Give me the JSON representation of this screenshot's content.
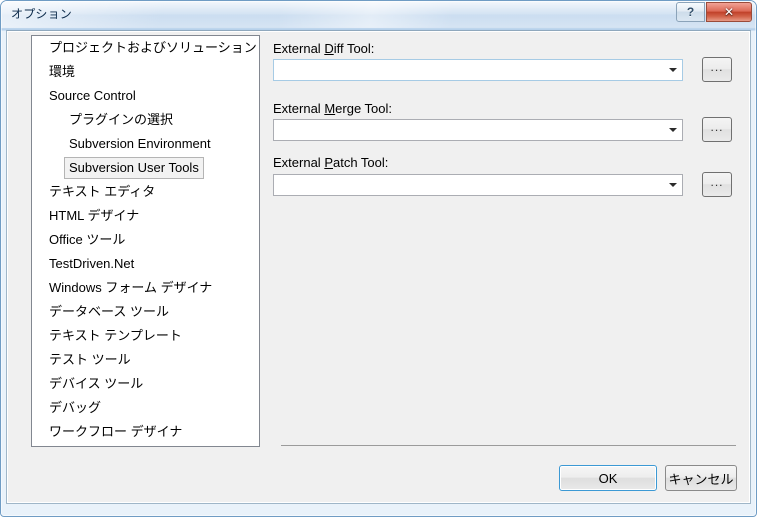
{
  "window": {
    "title": "オプション",
    "caption_buttons": [
      {
        "name": "help-button",
        "glyph": "?"
      },
      {
        "name": "close-button",
        "glyph": "✕"
      }
    ]
  },
  "tree": {
    "items": [
      {
        "label": "プロジェクトおよびソリューション",
        "level": 0,
        "selected": false
      },
      {
        "label": "環境",
        "level": 0,
        "selected": false
      },
      {
        "label": "Source Control",
        "level": 0,
        "selected": false
      },
      {
        "label": "プラグインの選択",
        "level": 1,
        "selected": false
      },
      {
        "label": "Subversion Environment",
        "level": 1,
        "selected": false
      },
      {
        "label": "Subversion User Tools",
        "level": 1,
        "selected": true
      },
      {
        "label": "テキスト エディタ",
        "level": 0,
        "selected": false
      },
      {
        "label": "HTML デザイナ",
        "level": 0,
        "selected": false
      },
      {
        "label": "Office ツール",
        "level": 0,
        "selected": false
      },
      {
        "label": "TestDriven.Net",
        "level": 0,
        "selected": false
      },
      {
        "label": "Windows フォーム デザイナ",
        "level": 0,
        "selected": false
      },
      {
        "label": "データベース ツール",
        "level": 0,
        "selected": false
      },
      {
        "label": "テキスト テンプレート",
        "level": 0,
        "selected": false
      },
      {
        "label": "テスト ツール",
        "level": 0,
        "selected": false
      },
      {
        "label": "デバイス ツール",
        "level": 0,
        "selected": false
      },
      {
        "label": "デバッグ",
        "level": 0,
        "selected": false
      },
      {
        "label": "ワークフロー デザイナ",
        "level": 0,
        "selected": false
      }
    ]
  },
  "pane": {
    "fields": [
      {
        "label_before": "External ",
        "label_accel": "D",
        "label_after": "iff Tool:",
        "label_full": "External Diff Tool:",
        "value": "",
        "placeholder": "",
        "focused": true,
        "browse_label": "...",
        "name": "external-diff-tool"
      },
      {
        "label_before": "External ",
        "label_accel": "M",
        "label_after": "erge Tool:",
        "label_full": "External Merge Tool:",
        "value": "",
        "placeholder": "",
        "focused": false,
        "browse_label": "...",
        "name": "external-merge-tool"
      },
      {
        "label_before": "External ",
        "label_accel": "P",
        "label_after": "atch Tool:",
        "label_full": "External Patch Tool:",
        "value": "",
        "placeholder": "",
        "focused": false,
        "browse_label": "...",
        "name": "external-patch-tool"
      }
    ]
  },
  "footer": {
    "ok_label": "OK",
    "cancel_label": "キャンセル"
  },
  "colors": {
    "titlebar": "#c9dcf0",
    "dialog_bg": "#f0f0f0",
    "close_button": "#c0412a",
    "default_button_border": "#3c99d4",
    "selection_bg": "#f2f2f2"
  }
}
